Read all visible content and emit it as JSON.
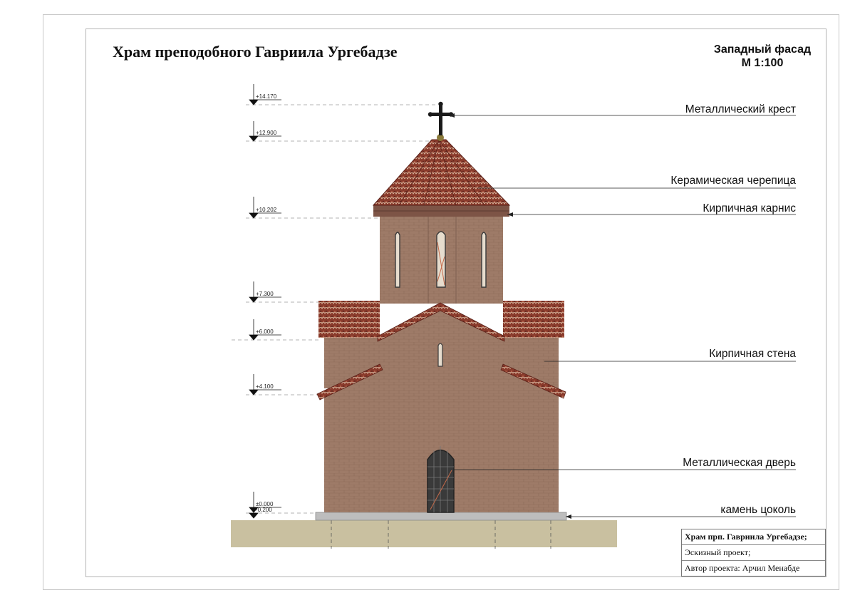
{
  "title": "Храм преподобного Гавриила Ургебадзе",
  "facade": {
    "name": "Западный фасад",
    "scale": "М 1:100"
  },
  "levels": [
    "+14.170",
    "+12.900",
    "+10.202",
    "+7.300",
    "+6.000",
    "+4.100",
    "±0.000",
    "-0.200"
  ],
  "callouts": [
    "Металлический крест",
    "Керамическая черепица",
    "Кирпичная  карнис",
    "Кирпичная стена",
    "Металлическая дверь",
    "камень цоколь"
  ],
  "stamp": {
    "project_title": "Храм прп. Гавриила Ургебадзе;",
    "stage": "Эскизный проект;",
    "author": "Автор проекта: Арчил Менабде"
  },
  "colors": {
    "brick": "#9e7b68",
    "roof_tile": "#8a3b2c",
    "ground": "#c9c0a0",
    "plinth": "#bdbdbd",
    "metal": "#3a3a3a"
  }
}
